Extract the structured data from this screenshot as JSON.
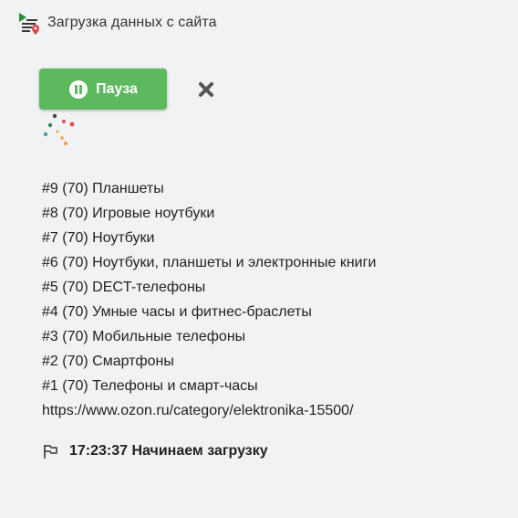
{
  "header": {
    "title": "Загрузка данных с сайта",
    "icon": "list-play-location-icon"
  },
  "controls": {
    "pause_label": "Пауза",
    "pause_icon": "pause-circle-icon",
    "close_icon": "close-x-icon",
    "spinner_icon": "loading-dots-spinner-icon"
  },
  "colors": {
    "background": "#f1f2f4",
    "button_green": "#5cb95d",
    "icon_green": "#2e8b3e",
    "marker_red": "#e04040",
    "close_gray": "#555555"
  },
  "log": {
    "lines": [
      "#9 (70) Планшеты",
      "#8 (70) Игровые ноутбуки",
      "#7 (70) Ноутбуки",
      "#6 (70) Ноутбуки, планшеты и электронные книги",
      "#5 (70) DECT-телефоны",
      "#4 (70) Умные часы и фитнес-браслеты",
      "#3 (70) Мобильные телефоны",
      "#2 (70) Смартфоны",
      "#1 (70) Телефоны и смарт-часы",
      "https://www.ozon.ru/category/elektronika-15500/"
    ]
  },
  "status": {
    "icon": "flag-icon",
    "text": "17:23:37 Начинаем загрузку"
  }
}
